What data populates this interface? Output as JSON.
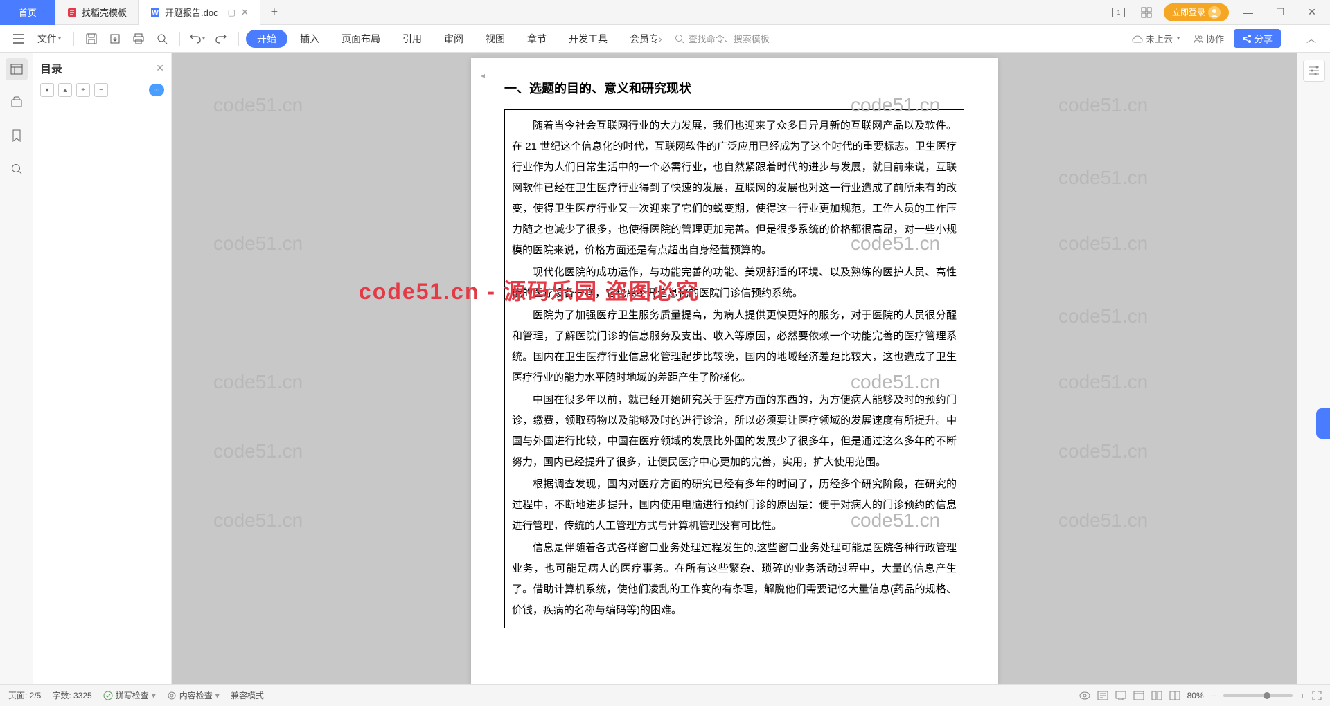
{
  "titlebar": {
    "tabs": {
      "home": "首页",
      "template": "找稻壳模板",
      "active": "开题报告.doc"
    },
    "login": "立即登录"
  },
  "toolbar": {
    "file": "文件",
    "menus": {
      "start": "开始",
      "insert": "插入",
      "layout": "页面布局",
      "reference": "引用",
      "review": "审阅",
      "view": "视图",
      "chapter": "章节",
      "devtools": "开发工具",
      "member": "会员专"
    },
    "search_placeholder": "查找命令、搜索模板",
    "cloud": "未上云",
    "collab": "协作",
    "share": "分享"
  },
  "outline": {
    "title": "目录"
  },
  "document": {
    "heading": "一、选题的目的、意义和研究现状",
    "p1": "随着当今社会互联网行业的大力发展，我们也迎来了众多日异月新的互联网产品以及软件。在 21 世纪这个信息化的时代，互联网软件的广泛应用已经成为了这个时代的重要标志。卫生医疗行业作为人们日常生活中的一个必需行业，也自然紧跟着时代的进步与发展，就目前来说，互联网软件已经在卫生医疗行业得到了快速的发展，互联网的发展也对这一行业造成了前所未有的改变，使得卫生医疗行业又一次迎来了它们的蜕变期，使得这一行业更加规范，工作人员的工作压力随之也减少了很多，也使得医院的管理更加完善。但是很多系统的价格都很高昂，对一些小规模的医院来说，价格方面还是有点超出自身经营预算的。",
    "p2": "现代化医院的成功运作，与功能完善的功能、美观舒适的环境、以及熟练的医护人员、高性能的医疗设备一样，它也离不开信息化的医院门诊信预约系统。",
    "p3": "医院为了加强医疗卫生服务质量提高，为病人提供更快更好的服务，对于医院的人员很分醒和管理，了解医院门诊的信息服务及支出、收入等原因，必然要依赖一个功能完善的医疗管理系统。国内在卫生医疗行业信息化管理起步比较晚，国内的地域经济差距比较大，这也造成了卫生医疗行业的能力水平随时地域的差距产生了阶梯化。",
    "p4": "中国在很多年以前，就已经开始研究关于医疗方面的东西的，为方便病人能够及时的预约门诊，缴费，领取药物以及能够及时的进行诊治，所以必须要让医疗领域的发展速度有所提升。中国与外国进行比较，中国在医疗领域的发展比外国的发展少了很多年，但是通过这么多年的不断努力，国内已经提升了很多，让便民医疗中心更加的完善，实用，扩大使用范围。",
    "p5": "根据调查发现，国内对医疗方面的研究已经有多年的时间了，历经多个研究阶段，在研究的过程中，不断地进步提升，国内使用电脑进行预约门诊的原因是：便于对病人的门诊预约的信息进行管理，传统的人工管理方式与计算机管理没有可比性。",
    "p6": "信息是伴随着各式各样窗口业务处理过程发生的,这些窗口业务处理可能是医院各种行政管理业务，也可能是病人的医疗事务。在所有这些繁杂、琐碎的业务活动过程中，大量的信息产生了。借助计算机系统，使他们凌乱的工作变的有条理，解脱他们需要记忆大量信息(药品的规格、价钱，疾病的名称与编码等)的困难。"
  },
  "watermark": {
    "gray": "code51.cn",
    "red": "code51.cn - 源码乐园 盗图必究"
  },
  "statusbar": {
    "page": "页面: 2/5",
    "words": "字数: 3325",
    "spellcheck": "拼写检查",
    "contentcheck": "内容检查",
    "compat": "兼容模式",
    "zoom": "80%"
  }
}
